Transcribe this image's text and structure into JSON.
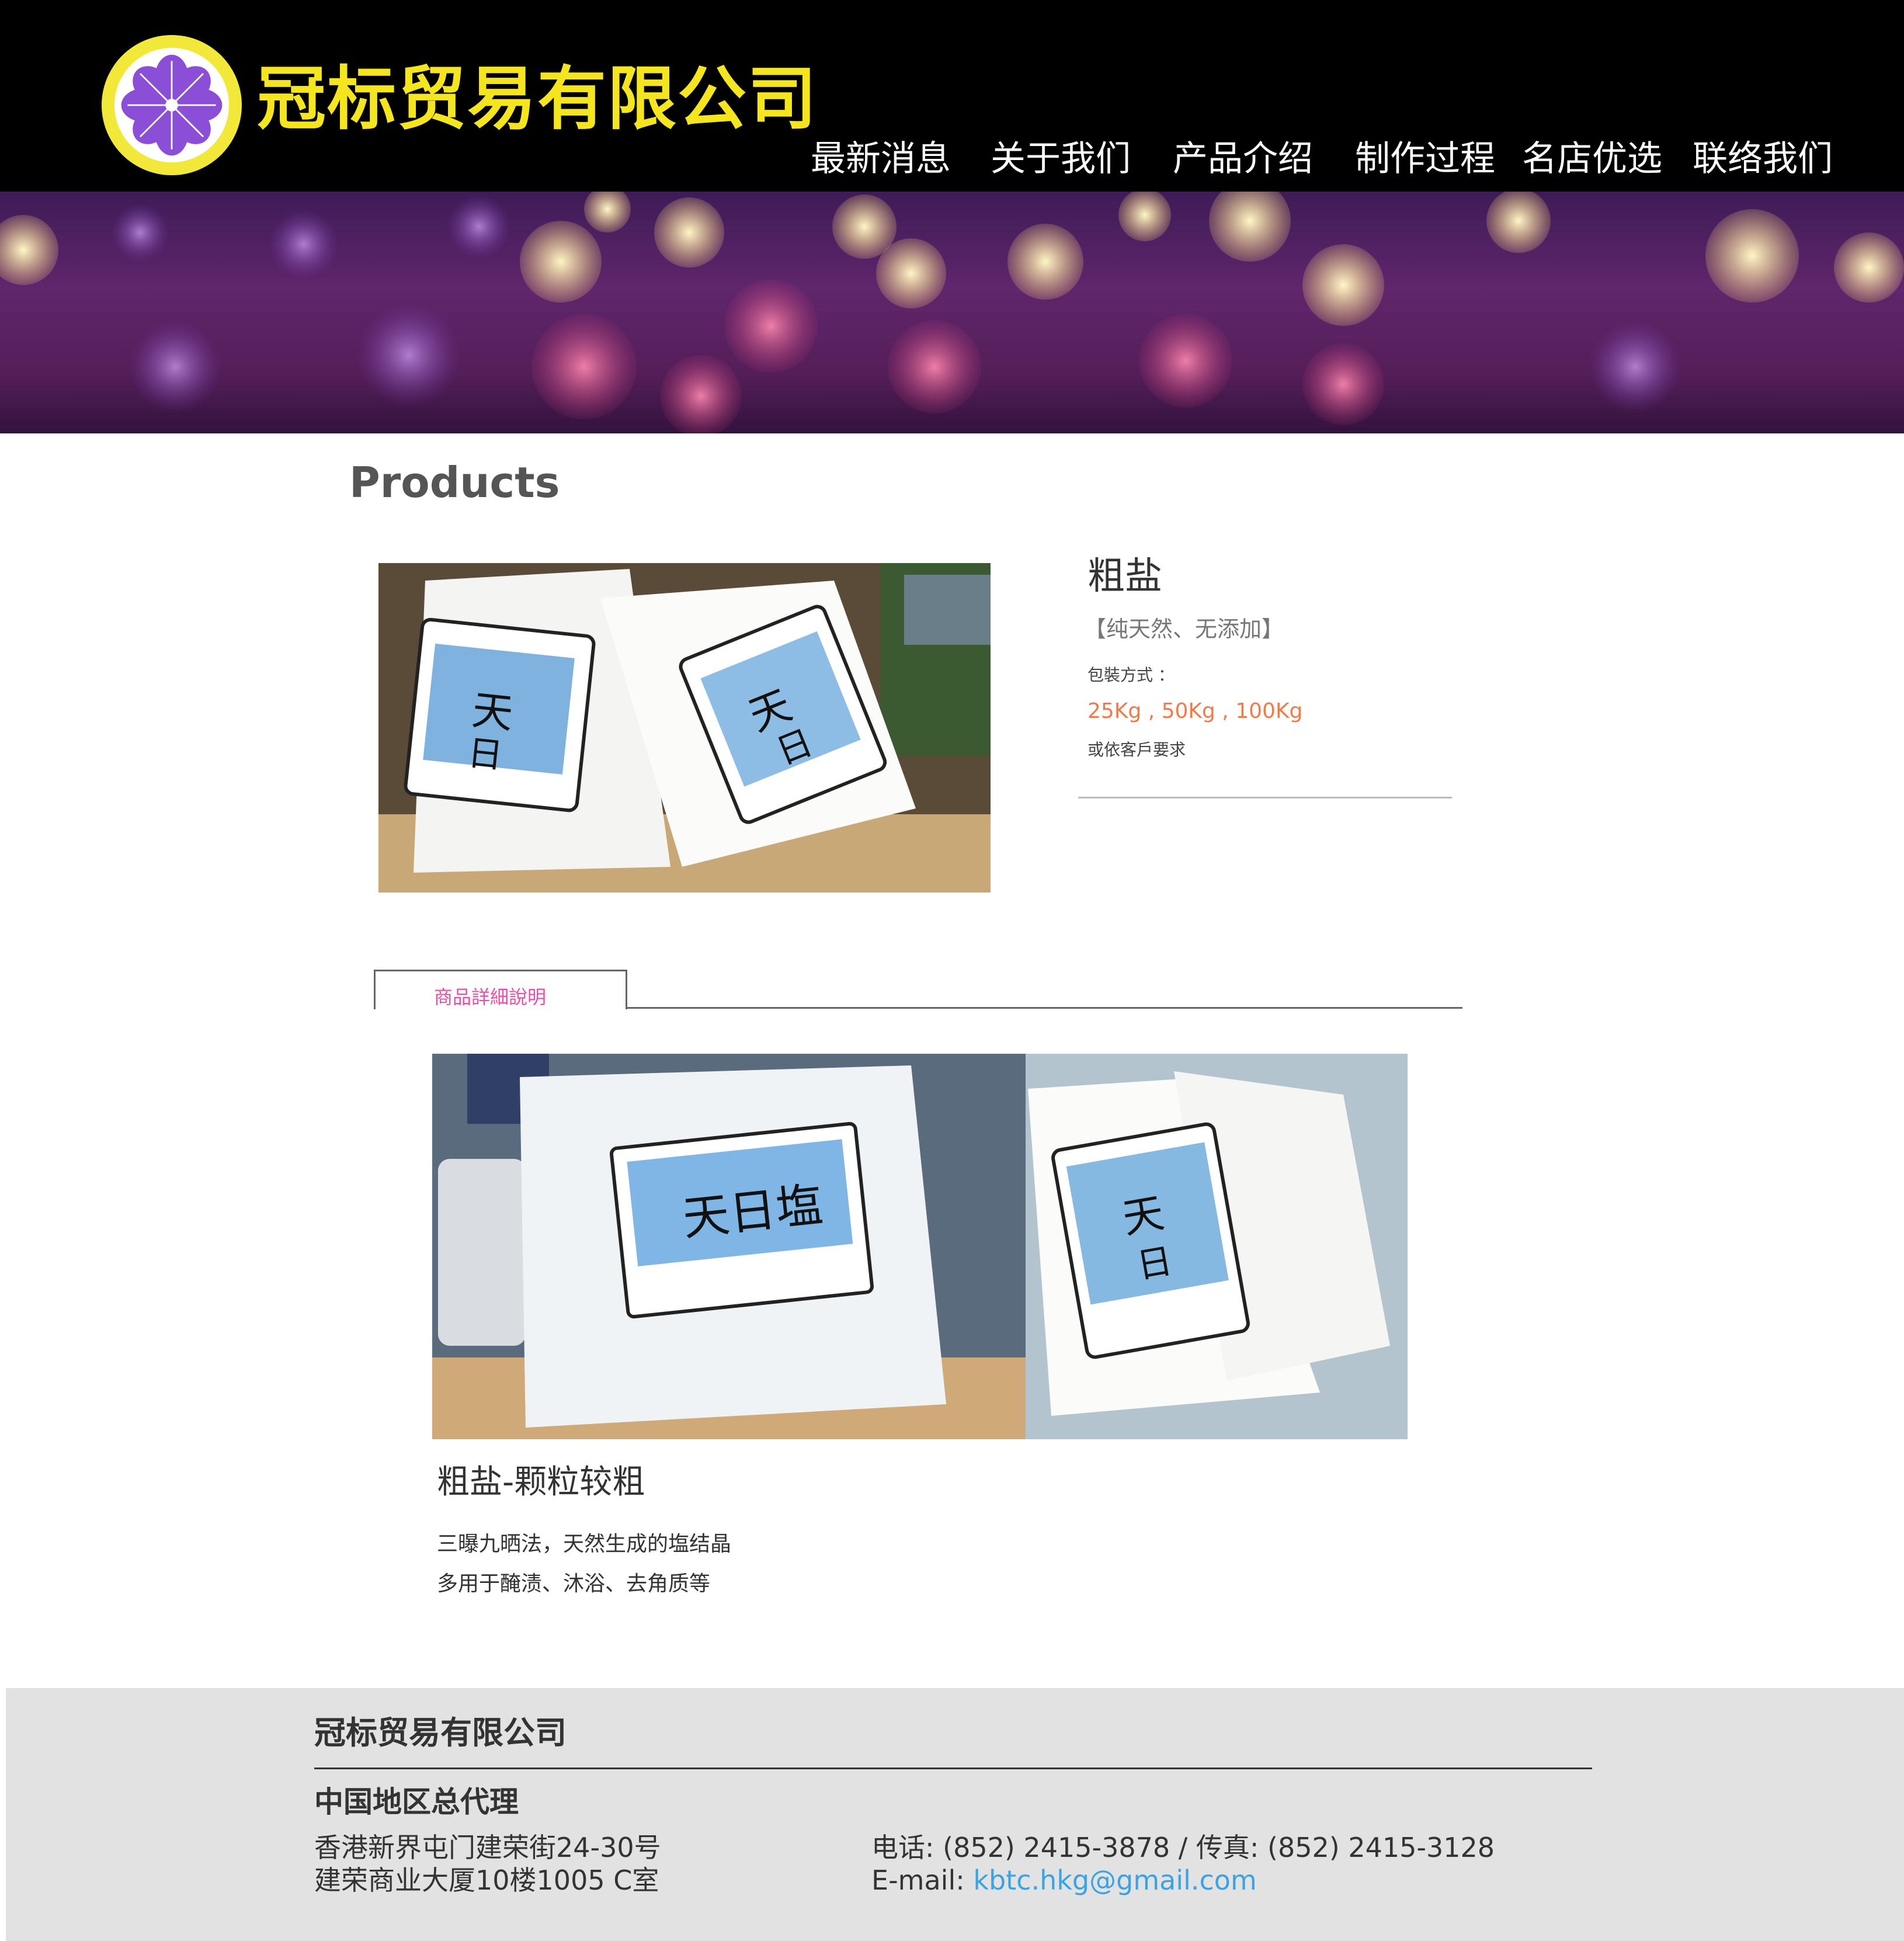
{
  "header": {
    "company_name": "冠标贸易有限公司",
    "logo_icon": "purple-flower-icon",
    "nav": [
      {
        "label": "最新消息"
      },
      {
        "label": "关于我们"
      },
      {
        "label": "产品介绍"
      },
      {
        "label": "制作过程"
      },
      {
        "label": "名店优选"
      },
      {
        "label": "联络我们"
      }
    ]
  },
  "main": {
    "page_title": "Products",
    "product": {
      "name": "粗盐",
      "tagline": "【纯天然、无添加】",
      "pack_label": "包裝方式 ：",
      "pack_sizes": "25Kg , 50Kg , 100Kg",
      "pack_note": "或依客戶要求"
    },
    "tab": {
      "label": "商品詳細說明"
    },
    "detail": {
      "title": "粗盐-颗粒较粗",
      "lines": [
        "三曝九晒法，天然生成的塩结晶",
        "多用于醃渍、沐浴、去角质等"
      ]
    }
  },
  "footer": {
    "company": "冠标贸易有限公司",
    "agent": "中国地区总代理",
    "address_line1": "香港新界屯门建荣街24-30号",
    "address_line2": "建荣商业大厦10楼1005 C室",
    "phone_line": "电话: (852) 2415-3878 / 传真: (852) 2415-3128",
    "email_label": "E-mail: ",
    "email": "kbtc.hkg@gmail.com"
  },
  "colors": {
    "header_bg": "#000000",
    "brand_yellow": "#f5e51f",
    "tab_pink": "#e94da8",
    "pack_orange": "#f07a4a",
    "email_blue": "#3aa3e3",
    "footer_bg": "#e2e2e2"
  }
}
